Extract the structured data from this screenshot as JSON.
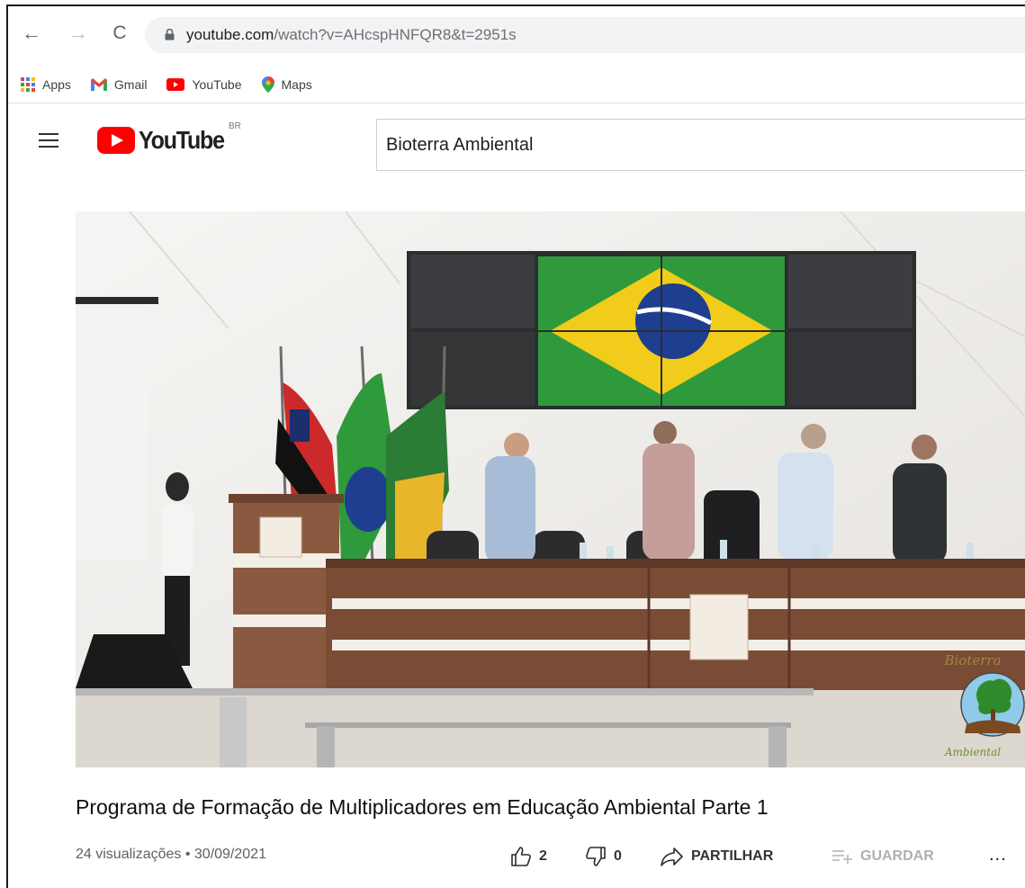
{
  "browser": {
    "url_host": "youtube.com",
    "url_rest": "/watch?v=AHcspHNFQR8&t=2951s",
    "bookmarks": [
      {
        "label": "Apps",
        "icon": "apps-grid-icon"
      },
      {
        "label": "Gmail",
        "icon": "gmail-icon"
      },
      {
        "label": "YouTube",
        "icon": "youtube-icon"
      },
      {
        "label": "Maps",
        "icon": "maps-pin-icon"
      }
    ]
  },
  "youtube": {
    "logo_text": "YouTube",
    "region": "BR",
    "search_value": "Bioterra Ambiental"
  },
  "video": {
    "watermark_top": "Bioterra",
    "watermark_bottom": "Ambiental",
    "title": "Programa de Formação de Multiplicadores em Educação Ambiental Parte 1",
    "views_date": "24 visualizações • 30/09/2021",
    "likes": "2",
    "dislikes": "0",
    "share_label": "PARTILHAR",
    "save_label": "GUARDAR",
    "more_label": "..."
  },
  "colors": {
    "youtube_red": "#ff0000",
    "brazil_green": "#2f9a3c",
    "brazil_yellow": "#f2cc1a",
    "brazil_blue": "#1e3f8f",
    "desk_brown": "#7a4b35"
  }
}
